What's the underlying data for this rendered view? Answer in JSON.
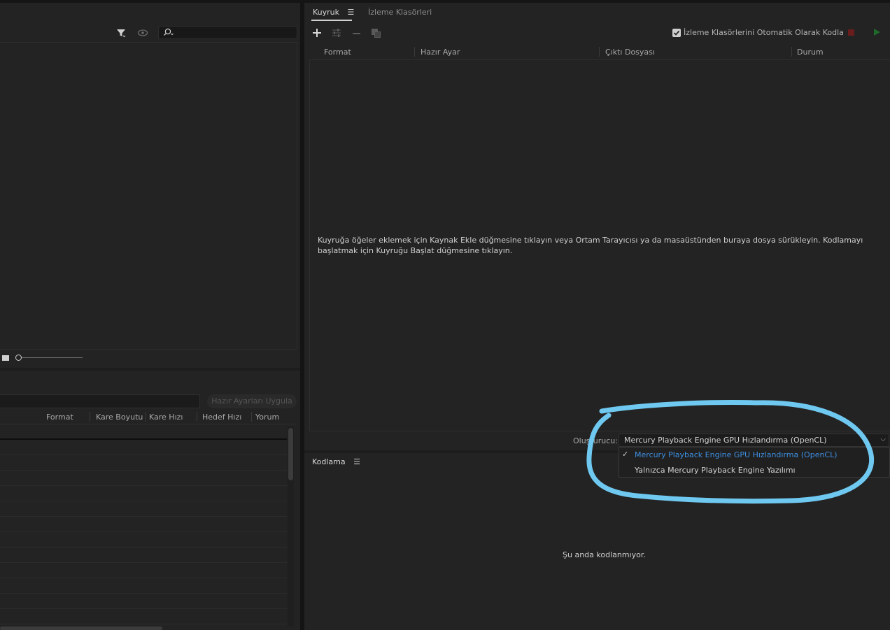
{
  "left_top": {
    "search_placeholder": ""
  },
  "left_bottom": {
    "apply_preset_label": "Hazır Ayarları Uygula",
    "columns": [
      "Format",
      "Kare Boyutu",
      "Kare Hızı",
      "Hedef Hızı",
      "Yorum"
    ]
  },
  "queue": {
    "tabs": [
      {
        "label": "Kuyruk"
      },
      {
        "label": "İzleme Klasörleri"
      }
    ],
    "auto_encode_label": "İzleme Klasörlerini Otomatik Olarak Kodla",
    "auto_encode_checked": true,
    "columns": [
      "Format",
      "Hazır Ayar",
      "Çıktı Dosyası",
      "Durum"
    ],
    "empty_message": "Kuyruğa öğeler eklemek için Kaynak Ekle düğmesine tıklayın veya Ortam Tarayıcısı ya da masaüstünden buraya dosya sürükleyin. Kodlamayı başlatmak için Kuyruğu Başlat düğmesine tıklayın.",
    "renderer_label": "Oluşturucu:",
    "renderer_value": "Mercury Playback Engine GPU Hızlandırma (OpenCL)",
    "renderer_options": [
      {
        "label": "Mercury Playback Engine GPU Hızlandırma (OpenCL)",
        "selected": true
      },
      {
        "label": "Yalnızca Mercury Playback Engine Yazılımı",
        "selected": false
      }
    ]
  },
  "encoding": {
    "tab_label": "Kodlama",
    "status_text": "Şu anda kodlanmıyor."
  },
  "colors": {
    "accent_blue": "#3d8fe0",
    "highlight_circle": "#6fc8f0",
    "stop_red": "#7a1f1f",
    "play_green": "#1e6b2a"
  },
  "icons": {
    "filter": "filter-icon",
    "eye": "eye-icon",
    "search": "search-icon",
    "add": "plus-icon",
    "settings": "sliders-icon",
    "remove": "minus-icon",
    "duplicate": "duplicate-icon",
    "stop": "stop-icon",
    "play": "play-icon",
    "menu": "hamburger-icon",
    "check": "checkmark-icon",
    "chevron": "chevron-down-icon"
  }
}
